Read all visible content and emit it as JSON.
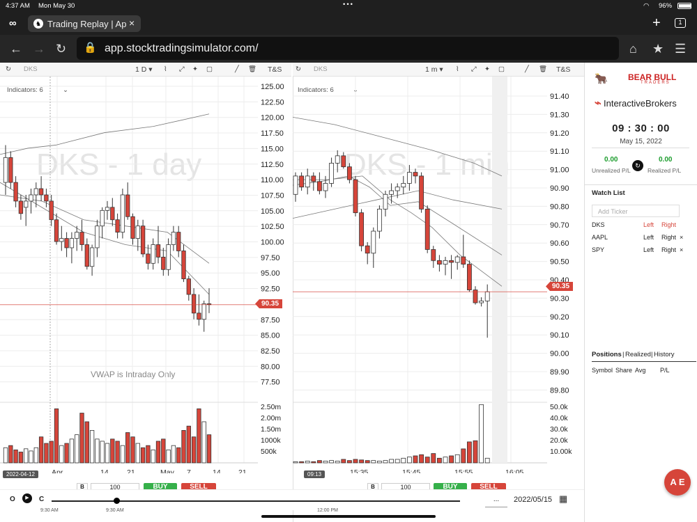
{
  "status_bar": {
    "time": "4:37 AM",
    "date": "Mon May 30",
    "battery": "96%"
  },
  "browser": {
    "tab_title": "Trading Replay | Ap",
    "tab_count": "1",
    "url": "app.stocktradingsimulator.com/"
  },
  "left_chart": {
    "ticker": "DKS",
    "interval": "1 D",
    "ts_label": "T&S",
    "indicators": "Indicators: 6",
    "watermark": "DKS - 1 day",
    "vwap_note": "VWAP is Intraday Only",
    "price_tag": "90.35",
    "date_tag": "2022-04-12",
    "y_labels": [
      "125.00",
      "122.50",
      "120.00",
      "117.50",
      "115.00",
      "112.50",
      "110.00",
      "107.50",
      "105.00",
      "102.50",
      "100.00",
      "97.50",
      "95.00",
      "92.50",
      "87.50",
      "85.00",
      "82.50",
      "80.00",
      "77.50"
    ],
    "vol_labels": [
      "2.50m",
      "2.00m",
      "1.50m",
      "1000k",
      "500k"
    ],
    "x_labels": [
      "Apr",
      "14",
      "21",
      "May",
      "7",
      "14",
      "21"
    ],
    "qty": "100",
    "buy": "BUY",
    "sell": "SELL"
  },
  "right_chart": {
    "ticker": "DKS",
    "interval": "1 m",
    "ts_label": "T&S",
    "indicators": "Indicators: 6",
    "watermark": "DKS - 1 min",
    "price_tag": "90.35",
    "time_tag": "09:13",
    "y_labels": [
      "91.40",
      "91.30",
      "91.20",
      "91.10",
      "91.00",
      "90.90",
      "90.80",
      "90.70",
      "90.60",
      "90.50",
      "90.40",
      "90.30",
      "90.20",
      "90.10",
      "90.00",
      "89.90",
      "89.80"
    ],
    "vol_labels": [
      "50.0k",
      "40.0k",
      "30.0k",
      "20.0k",
      "10.00k"
    ],
    "x_labels": [
      "15:35",
      "15:45",
      "15:55",
      "16:05"
    ],
    "qty": "100",
    "buy": "BUY",
    "sell": "SELL"
  },
  "replay": {
    "controls": [
      "O",
      "C"
    ],
    "interval_select": "...",
    "date": "2022/05/15",
    "time_labels": [
      "9:30 AM",
      "9:30 AM",
      "12:00 PM"
    ]
  },
  "side_panel": {
    "brand1_top": "BEAR BULL",
    "brand1_bottom": "TRADERS",
    "brand2": "InteractiveBrokers",
    "clock": "09 : 30 : 00",
    "date": "May 15, 2022",
    "unrealized_value": "0.00",
    "unrealized_label": "Unrealized P/L",
    "realized_value": "0.00",
    "realized_label": "Realized P/L",
    "watchlist_title": "Watch List",
    "add_ticker_placeholder": "Add Ticker",
    "watchlist": [
      {
        "symbol": "DKS",
        "left": "Left",
        "right": "Right",
        "remove": ""
      },
      {
        "symbol": "AAPL",
        "left": "Left",
        "right": "Right",
        "remove": "×"
      },
      {
        "symbol": "SPY",
        "left": "Left",
        "right": "Right",
        "remove": "×"
      }
    ],
    "positions_tabs": [
      "Positions",
      "Realized",
      "History"
    ],
    "positions_headers": [
      "Symbol",
      "Share",
      "Avg",
      "P/L"
    ],
    "fab_label": "A E"
  },
  "colors": {
    "up": "#ffffff",
    "down": "#d6453a",
    "accent": "#d6453a",
    "buy": "#36b04a"
  }
}
